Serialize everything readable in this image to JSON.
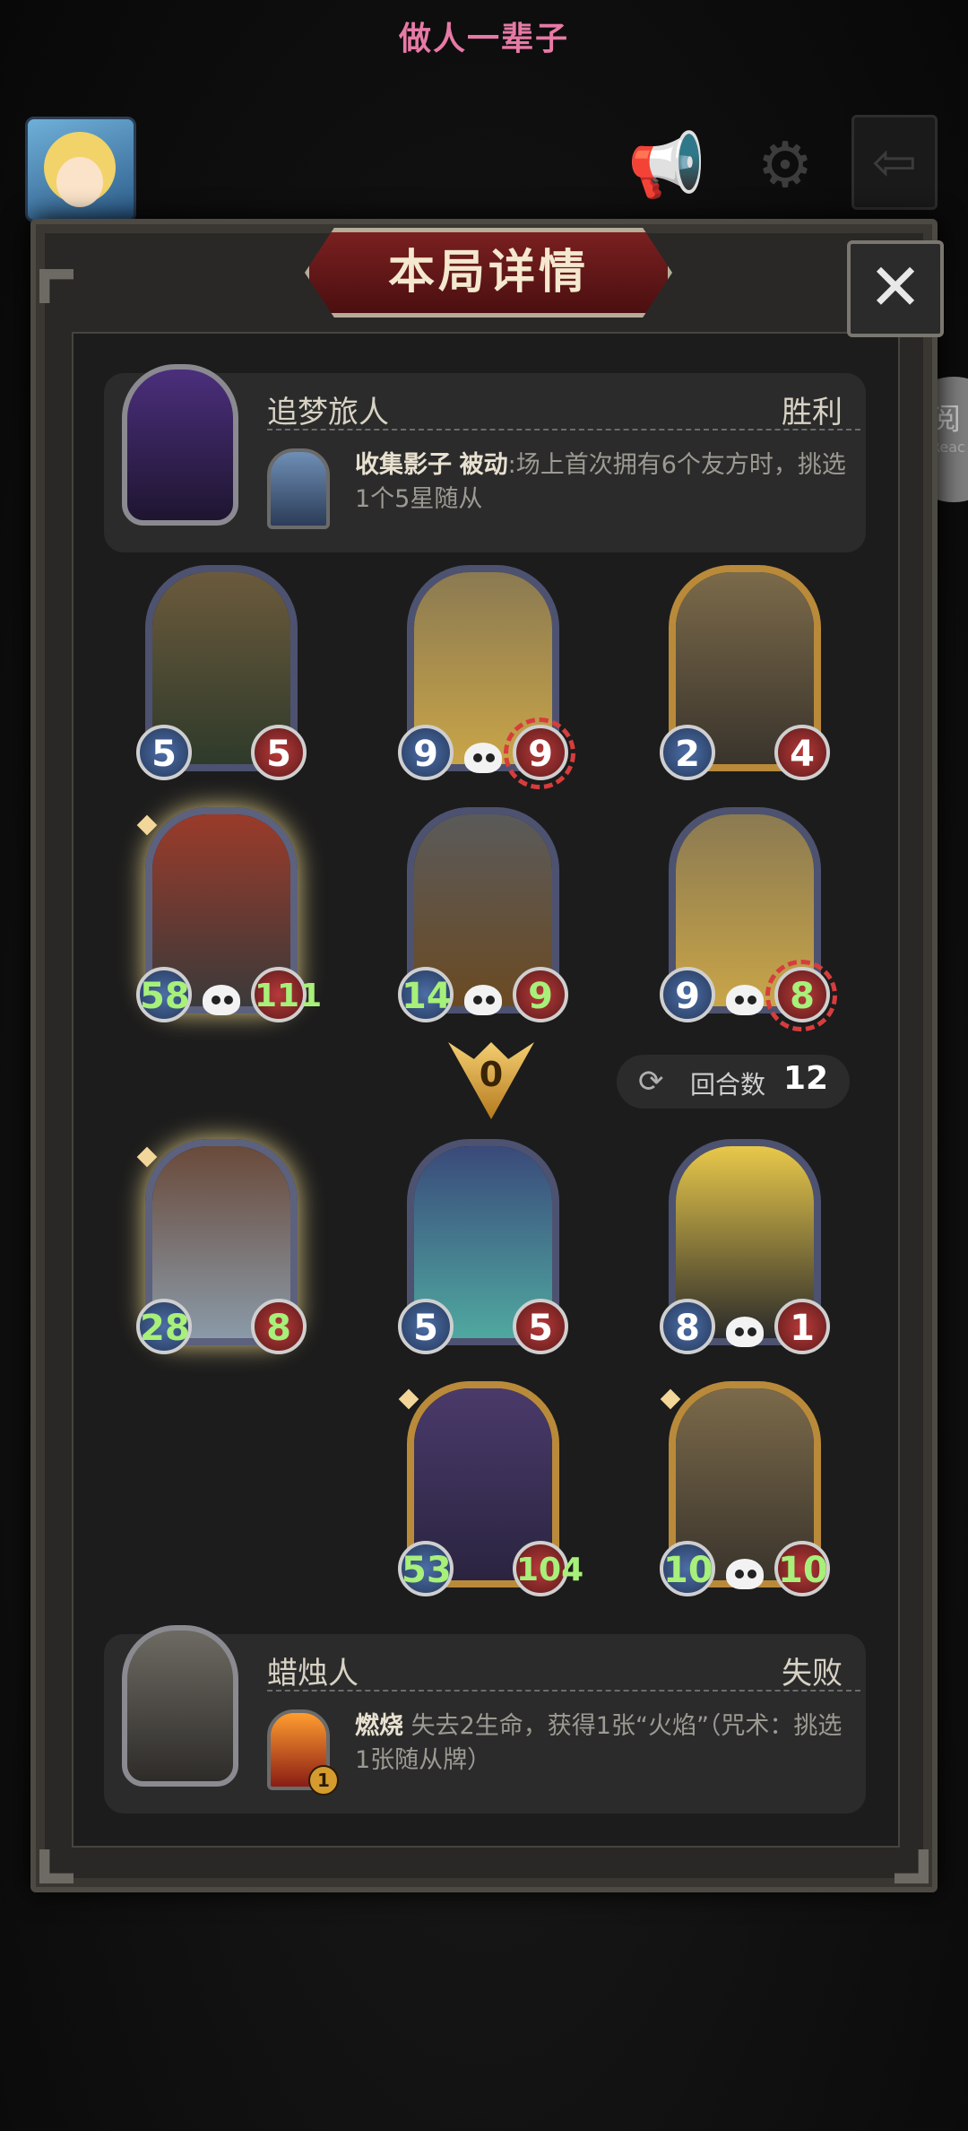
{
  "status_bar": {
    "title": "做人一辈子"
  },
  "top_icons": {
    "speaker": "speaker-icon",
    "gear": "gear-icon",
    "exit": "exit-arrow-icon"
  },
  "read_button": {
    "label": "阅",
    "sub": "Reac"
  },
  "panel": {
    "title": "本局详情",
    "close_label": "✕"
  },
  "winner": {
    "name": "追梦旅人",
    "result": "胜利",
    "power_bold": "收集影子",
    "power_tag": "被动",
    "power_desc": ":场上首次拥有6个友方时，挑选1个5星随从"
  },
  "loser": {
    "name": "蜡烛人",
    "result": "失败",
    "power_bold": "燃烧",
    "power_desc": "失去2生命，获得1张“火焰”（咒术：挑选1张随从牌）",
    "power_cost": "1"
  },
  "winner_board": [
    {
      "atk": "5",
      "hp": "5",
      "frame": "blue",
      "skull": false,
      "atk_buff": false,
      "hp_buff": false
    },
    {
      "atk": "9",
      "hp": "9",
      "frame": "blue",
      "skull": true,
      "atk_buff": false,
      "hp_buff": false,
      "shield": true
    },
    {
      "atk": "2",
      "hp": "4",
      "frame": "gold",
      "skull": false,
      "atk_buff": false,
      "hp_buff": false
    },
    {
      "atk": "58",
      "hp": "111",
      "frame": "glow",
      "skull": true,
      "atk_buff": true,
      "hp_buff": true
    },
    {
      "atk": "14",
      "hp": "9",
      "frame": "blue",
      "skull": true,
      "atk_buff": true,
      "hp_buff": true
    },
    {
      "atk": "9",
      "hp": "8",
      "frame": "blue",
      "skull": true,
      "atk_buff": false,
      "hp_buff": true,
      "shield": true
    }
  ],
  "result_marker": {
    "value": "0",
    "turn_label": "回合数",
    "turn_value": "12"
  },
  "loser_board": [
    {
      "atk": "28",
      "hp": "8",
      "frame": "glow",
      "skull": false,
      "atk_buff": true,
      "hp_buff": true
    },
    {
      "atk": "5",
      "hp": "5",
      "frame": "blue",
      "skull": false,
      "atk_buff": false,
      "hp_buff": false
    },
    {
      "atk": "8",
      "hp": "1",
      "frame": "blue",
      "skull": true,
      "atk_buff": false,
      "hp_buff": false
    },
    {
      "atk": "53",
      "hp": "104",
      "frame": "gold",
      "skull": false,
      "atk_buff": true,
      "hp_buff": true
    },
    {
      "atk": "10",
      "hp": "10",
      "frame": "gold",
      "skull": true,
      "atk_buff": true,
      "hp_buff": true
    }
  ],
  "colors": {
    "status_title": "#e77aa6",
    "panel_bg": "#1c1c1c",
    "buff_green": "#a7f07a"
  }
}
